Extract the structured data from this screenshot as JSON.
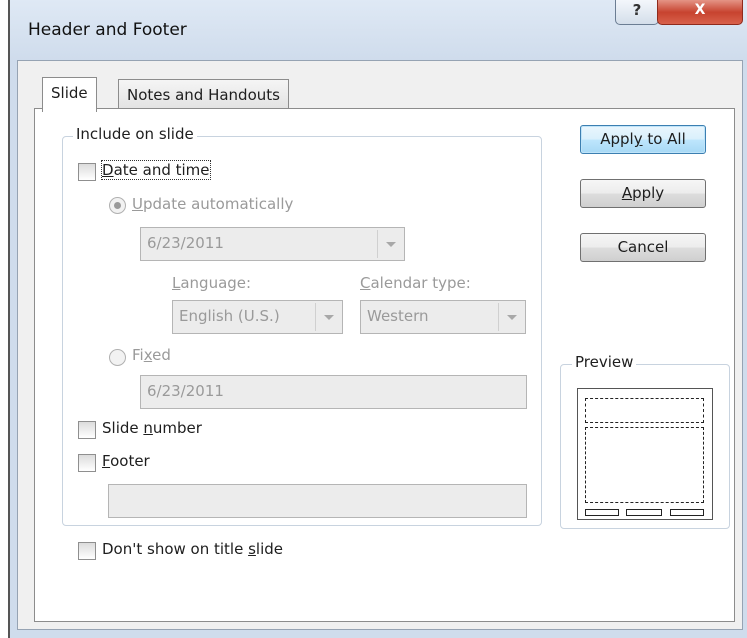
{
  "window": {
    "title": "Header and Footer",
    "help_icon": "?",
    "close_icon": "X"
  },
  "tabs": [
    {
      "label": "Slide",
      "active": true
    },
    {
      "label": "Notes and Handouts",
      "active": false
    }
  ],
  "include_group": {
    "legend": "Include on slide",
    "date_time": {
      "label_ul": "D",
      "label_rest": "ate and time",
      "checked": false,
      "update_auto": {
        "label_ul": "U",
        "label_rest": "pdate automatically",
        "selected": true
      },
      "date_value": "6/23/2011",
      "language": {
        "label_pre": "",
        "label_ul": "L",
        "label_rest": "anguage:",
        "value": "English (U.S.)"
      },
      "calendar": {
        "label_ul": "C",
        "label_rest": "alendar type:",
        "value": "Western"
      },
      "fixed": {
        "label_pre": "Fi",
        "label_ul": "x",
        "label_rest": "ed",
        "selected": false,
        "value": "6/23/2011"
      }
    },
    "slide_number": {
      "label_pre": "Slide ",
      "label_ul": "n",
      "label_rest": "umber",
      "checked": false
    },
    "footer": {
      "label_ul": "F",
      "label_rest": "ooter",
      "checked": false,
      "value": ""
    }
  },
  "dont_show": {
    "label_pre": "Don't show on title ",
    "label_ul": "s",
    "label_rest": "lide",
    "checked": false
  },
  "buttons": {
    "apply_all_pre": "Appl",
    "apply_all_ul": "y",
    "apply_all_rest": " to All",
    "apply_ul": "A",
    "apply_rest": "pply",
    "cancel": "Cancel"
  },
  "preview": {
    "legend": "Preview"
  }
}
